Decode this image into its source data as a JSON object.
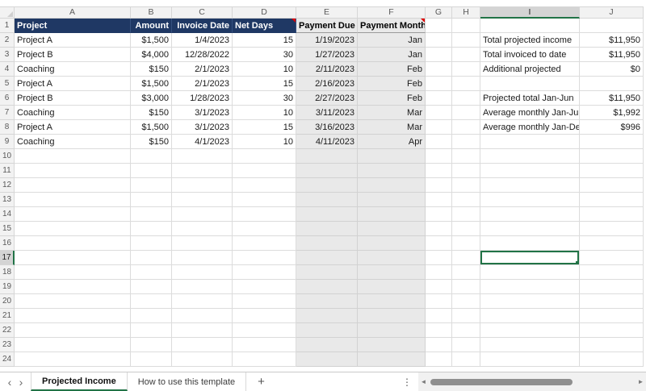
{
  "colors": {
    "accent_green": "#217346",
    "header_navy": "#1F3864",
    "shaded_column": "#E9E9E9",
    "comment_flag_red": "#E00000"
  },
  "sheet": {
    "columns": [
      "A",
      "B",
      "C",
      "D",
      "E",
      "F",
      "G",
      "H",
      "I",
      "J"
    ],
    "row_count": 24,
    "selection": {
      "cell": "I17",
      "column": "I",
      "row": 17
    },
    "header_row": {
      "A": "Project",
      "B": "Amount",
      "C": "Invoice Date",
      "D": "Net Days",
      "E": "Payment Due",
      "F": "Payment Month"
    },
    "comment_cells": [
      "D1",
      "F1"
    ],
    "records": [
      [
        "Project A",
        "$1,500",
        "1/4/2023",
        "15",
        "1/19/2023",
        "Jan"
      ],
      [
        "Project B",
        "$4,000",
        "12/28/2022",
        "30",
        "1/27/2023",
        "Jan"
      ],
      [
        "Coaching",
        "$150",
        "2/1/2023",
        "10",
        "2/11/2023",
        "Feb"
      ],
      [
        "Project A",
        "$1,500",
        "2/1/2023",
        "15",
        "2/16/2023",
        "Feb"
      ],
      [
        "Project B",
        "$3,000",
        "1/28/2023",
        "30",
        "2/27/2023",
        "Feb"
      ],
      [
        "Coaching",
        "$150",
        "3/1/2023",
        "10",
        "3/11/2023",
        "Mar"
      ],
      [
        "Project A",
        "$1,500",
        "3/1/2023",
        "15",
        "3/16/2023",
        "Mar"
      ],
      [
        "Coaching",
        "$150",
        "4/1/2023",
        "10",
        "4/11/2023",
        "Apr"
      ]
    ],
    "summary": [
      {
        "row": 2,
        "label": "Total projected income",
        "value": "$11,950"
      },
      {
        "row": 3,
        "label": "Total invoiced to date",
        "value": "$11,950"
      },
      {
        "row": 4,
        "label": "Additional projected",
        "value": "$0"
      },
      {
        "row": 6,
        "label": "Projected total Jan-Jun",
        "value": "$11,950"
      },
      {
        "row": 7,
        "label": "Average monthly Jan-Jun",
        "value": "$1,992"
      },
      {
        "row": 8,
        "label": "Average monthly Jan-Dec",
        "value": "$996"
      }
    ]
  },
  "tabbar": {
    "nav_left": "‹",
    "nav_right": "›",
    "tabs": [
      {
        "label": "Projected Income",
        "active": true
      },
      {
        "label": "How to use this template",
        "active": false
      }
    ],
    "add_label": "+",
    "menu_icon": "⋮",
    "scroll_left_icon": "◄",
    "scroll_right_icon": "►"
  }
}
